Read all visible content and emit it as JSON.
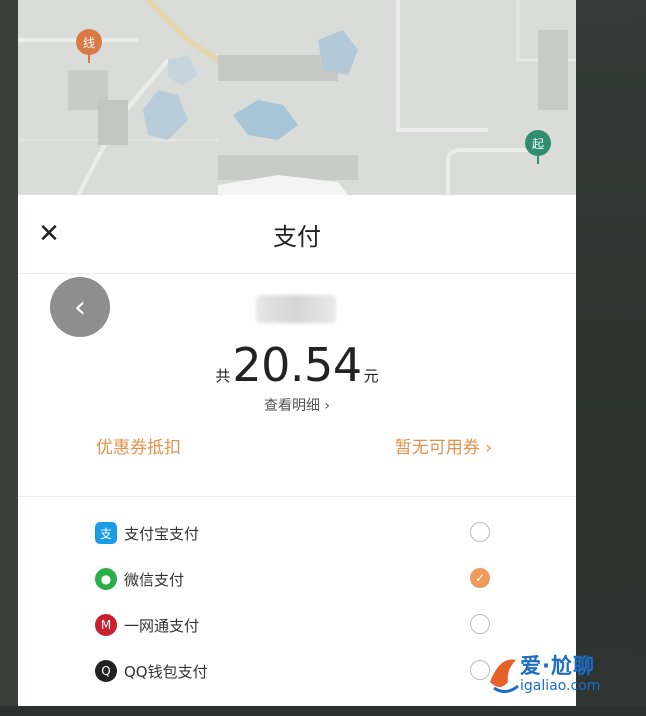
{
  "map": {
    "pin_line_label": "线",
    "pin_start_label": "起"
  },
  "header": {
    "close_label": "✕",
    "title": "支付"
  },
  "back_button": {
    "label": "‹"
  },
  "amount": {
    "prefix": "共",
    "value": "20.54",
    "unit": "元"
  },
  "detail_link": "查看明细 ›",
  "coupon": {
    "label": "优惠券抵扣",
    "value": "暂无可用券 ›"
  },
  "payment_methods": [
    {
      "label": "支付宝支付",
      "icon": "alipay-icon",
      "icon_glyph": "支",
      "color": "#1a9be6",
      "selected": false
    },
    {
      "label": "微信支付",
      "icon": "wechat-icon",
      "icon_glyph": "●",
      "color": "#2aae4a",
      "selected": true
    },
    {
      "label": "一网通支付",
      "icon": "yiwangtong-icon",
      "icon_glyph": "M",
      "color": "#c8202e",
      "selected": false
    },
    {
      "label": "QQ钱包支付",
      "icon": "qq-icon",
      "icon_glyph": "Q",
      "color": "#222222",
      "selected": false
    }
  ],
  "colors": {
    "accent": "#ee9a5b",
    "coupon_text": "#e0934e"
  },
  "watermark": {
    "line1": "爱·尬聊",
    "line2": "igaliao.com"
  }
}
